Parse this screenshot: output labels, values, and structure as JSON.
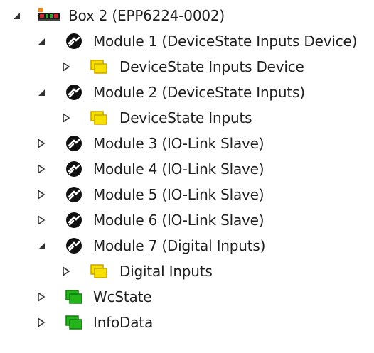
{
  "tree": {
    "items": [
      {
        "label": "Box 2 (EPP6224-0002)",
        "expanded": true,
        "icon": "box-icon"
      },
      {
        "label": "Module 1 (DeviceState Inputs Device)",
        "expanded": true,
        "icon": "module-icon"
      },
      {
        "label": "DeviceState Inputs Device",
        "expanded": false,
        "icon": "input-folder-icon"
      },
      {
        "label": "Module 2 (DeviceState Inputs)",
        "expanded": true,
        "icon": "module-icon"
      },
      {
        "label": "DeviceState Inputs",
        "expanded": false,
        "icon": "input-folder-icon"
      },
      {
        "label": "Module 3 (IO-Link Slave)",
        "expanded": false,
        "icon": "module-icon"
      },
      {
        "label": "Module 4 (IO-Link Slave)",
        "expanded": false,
        "icon": "module-icon"
      },
      {
        "label": "Module 5 (IO-Link Slave)",
        "expanded": false,
        "icon": "module-icon"
      },
      {
        "label": "Module 6 (IO-Link Slave)",
        "expanded": false,
        "icon": "module-icon"
      },
      {
        "label": "Module 7 (Digital Inputs)",
        "expanded": true,
        "icon": "module-icon"
      },
      {
        "label": "Digital Inputs",
        "expanded": false,
        "icon": "input-folder-icon"
      },
      {
        "label": "WcState",
        "expanded": false,
        "icon": "status-folder-icon"
      },
      {
        "label": "InfoData",
        "expanded": false,
        "icon": "status-folder-icon"
      }
    ]
  },
  "colors": {
    "text": "#1e1e1e",
    "input_folder_fill": "#f5e000",
    "input_folder_border": "#c9a400",
    "status_folder_fill": "#23b51a",
    "status_folder_border": "#137a0e",
    "module_icon": "#111111",
    "box_body": "#1a1a1a",
    "box_red": "#d3232a",
    "box_orange": "#f08a1c",
    "box_green": "#3aa03a"
  }
}
